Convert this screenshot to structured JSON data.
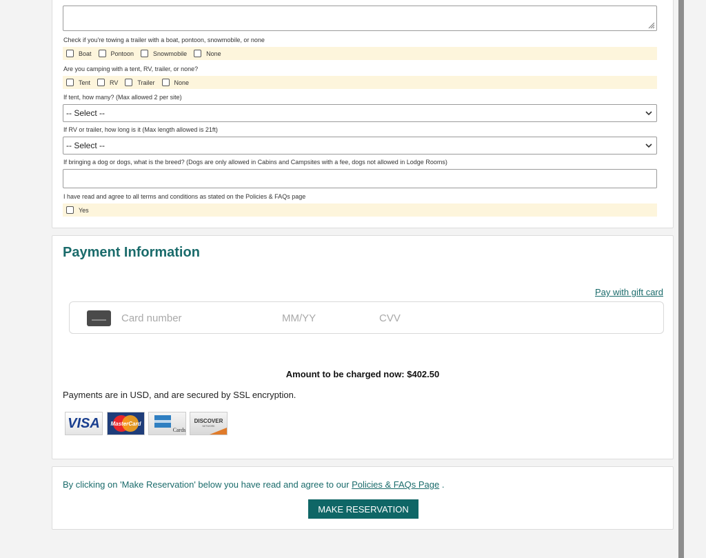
{
  "trailer": {
    "label": "Check if you're towing a trailer with a boat, pontoon, snowmobile, or none",
    "options": [
      "Boat",
      "Pontoon",
      "Snowmobile",
      "None"
    ]
  },
  "camping": {
    "label": "Are you camping with a tent, RV, trailer, or none?",
    "options": [
      "Tent",
      "RV",
      "Trailer",
      "None"
    ]
  },
  "tents": {
    "label": "If tent, how many? (Max allowed 2 per site)",
    "selected": "-- Select --"
  },
  "rv_length": {
    "label": "If RV or trailer, how long is it (Max length allowed is 21ft)",
    "selected": "-- Select --"
  },
  "dog": {
    "label": "If bringing a dog or dogs, what is the breed? (Dogs are only allowed in Cabins and Campsites with a fee, dogs not allowed in Lodge Rooms)",
    "value": ""
  },
  "terms": {
    "label": "I have read and agree to all terms and conditions as stated on the Policies & FAQs page",
    "option": "Yes"
  },
  "payment": {
    "title": "Payment Information",
    "gift_card_link": "Pay with gift card",
    "card_number_placeholder": "Card number",
    "expiry_placeholder": "MM/YY",
    "cvv_placeholder": "CVV",
    "amount_text": "Amount to be charged now: $402.50",
    "secure_text": "Payments are in USD, and are secured by SSL encryption.",
    "logos": {
      "visa": "VISA",
      "mastercard": "MasterCard",
      "amex": "Cards",
      "discover": "DISCOVER",
      "discover_sub": "NETWORK"
    }
  },
  "footer": {
    "agree_prefix": "By clicking on 'Make Reservation' below you have read and agree to our",
    "policies_link": "Policies & FAQs Page",
    "agree_suffix": ".",
    "make_reservation": "MAKE RESERVATION"
  },
  "colors": {
    "accent": "#1a6b6b",
    "button": "#0f6666",
    "option_row_bg": "#fdf5dc"
  }
}
